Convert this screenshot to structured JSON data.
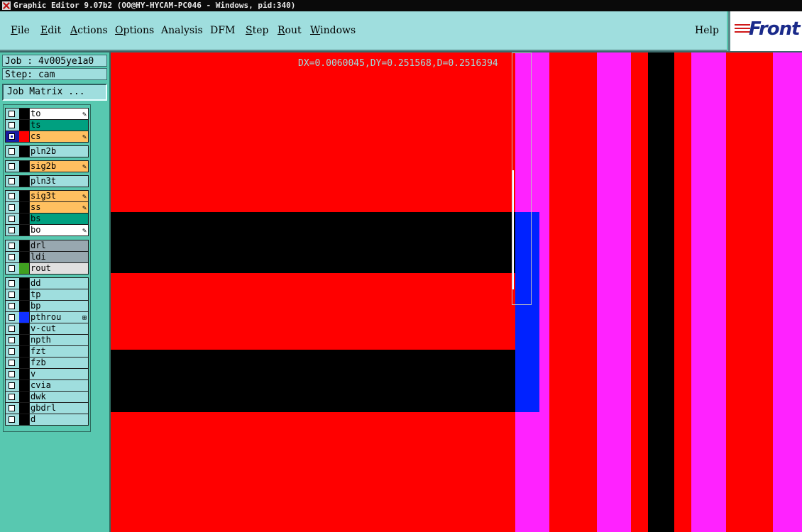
{
  "window": {
    "title": "Graphic Editor 9.07b2 (OO@HY-HYCAM-PC046 - Windows, pid:340)"
  },
  "menu": {
    "items": [
      {
        "label": "File",
        "u": "F",
        "rest": "ile"
      },
      {
        "label": "Edit",
        "u": "E",
        "rest": "dit"
      },
      {
        "label": "Actions",
        "u": "A",
        "rest": "ctions"
      },
      {
        "label": "Options",
        "u": "O",
        "rest": "ptions"
      },
      {
        "label": "Analysis",
        "u": "",
        "rest": "Analysis"
      },
      {
        "label": "DFM",
        "u": "",
        "rest": "DFM"
      },
      {
        "label": "Step",
        "u": "S",
        "rest": "tep"
      },
      {
        "label": "Rout",
        "u": "R",
        "rest": "out"
      },
      {
        "label": "Windows",
        "u": "W",
        "rest": "indows"
      }
    ],
    "help": "Help",
    "logo": "Front"
  },
  "panel": {
    "job": "Job : 4v005ye1a0",
    "step": "Step: cam",
    "job_matrix": "Job Matrix ..."
  },
  "layers": {
    "groups": [
      [
        {
          "name": "to",
          "bg": "#ffffff",
          "color": "#000000",
          "mark": "✎"
        },
        {
          "name": "ts",
          "bg": "#00a080",
          "color": "#000000",
          "mark": ""
        },
        {
          "name": "cs",
          "bg": "#ffc060",
          "color": "#ff0000",
          "mark": "✎",
          "active": true
        }
      ],
      [
        {
          "name": "pln2b",
          "bg": "#9fdede",
          "color": "#000000",
          "mark": ""
        }
      ],
      [
        {
          "name": "sig2b",
          "bg": "#ffc060",
          "color": "#000000",
          "mark": "✎"
        }
      ],
      [
        {
          "name": "pln3t",
          "bg": "#9fdede",
          "color": "#000000",
          "mark": ""
        }
      ],
      [
        {
          "name": "sig3t",
          "bg": "#ffc060",
          "color": "#000000",
          "mark": "✎"
        },
        {
          "name": "ss",
          "bg": "#ffc060",
          "color": "#000000",
          "mark": "✎"
        },
        {
          "name": "bs",
          "bg": "#00a080",
          "color": "#000000",
          "mark": ""
        },
        {
          "name": "bo",
          "bg": "#ffffff",
          "color": "#000000",
          "mark": "✎"
        }
      ],
      [
        {
          "name": "drl",
          "bg": "#98a8b0",
          "color": "#000000",
          "mark": ""
        },
        {
          "name": "ldi",
          "bg": "#98a8b0",
          "color": "#000000",
          "mark": ""
        },
        {
          "name": "rout",
          "bg": "#e0e0e0",
          "color": "#40a020",
          "mark": ""
        }
      ],
      [
        {
          "name": "dd",
          "bg": "#9fdede",
          "color": "#000000",
          "mark": ""
        },
        {
          "name": "tp",
          "bg": "#9fdede",
          "color": "#000000",
          "mark": ""
        },
        {
          "name": "bp",
          "bg": "#9fdede",
          "color": "#000000",
          "mark": ""
        },
        {
          "name": "pthrou",
          "bg": "#9fdede",
          "color": "#1030ff",
          "mark": "⊞"
        },
        {
          "name": "v-cut",
          "bg": "#9fdede",
          "color": "#000000",
          "mark": ""
        },
        {
          "name": "npth",
          "bg": "#9fdede",
          "color": "#000000",
          "mark": ""
        },
        {
          "name": "fzt",
          "bg": "#9fdede",
          "color": "#000000",
          "mark": ""
        },
        {
          "name": "fzb",
          "bg": "#9fdede",
          "color": "#000000",
          "mark": ""
        },
        {
          "name": "v",
          "bg": "#9fdede",
          "color": "#000000",
          "mark": ""
        },
        {
          "name": "cvia",
          "bg": "#9fdede",
          "color": "#000000",
          "mark": ""
        },
        {
          "name": "dwk",
          "bg": "#9fdede",
          "color": "#000000",
          "mark": ""
        },
        {
          "name": "gbdrl",
          "bg": "#9fdede",
          "color": "#000000",
          "mark": ""
        },
        {
          "name": "d",
          "bg": "#9fdede",
          "color": "#000000",
          "mark": ""
        }
      ]
    ]
  },
  "canvas": {
    "readout": "DX=0.0060045,DY=0.251568,D=0.2516394",
    "colors": {
      "red": "#ff0000",
      "black": "#000000",
      "blue": "#0022ff",
      "magenta": "#ff22ff"
    }
  }
}
